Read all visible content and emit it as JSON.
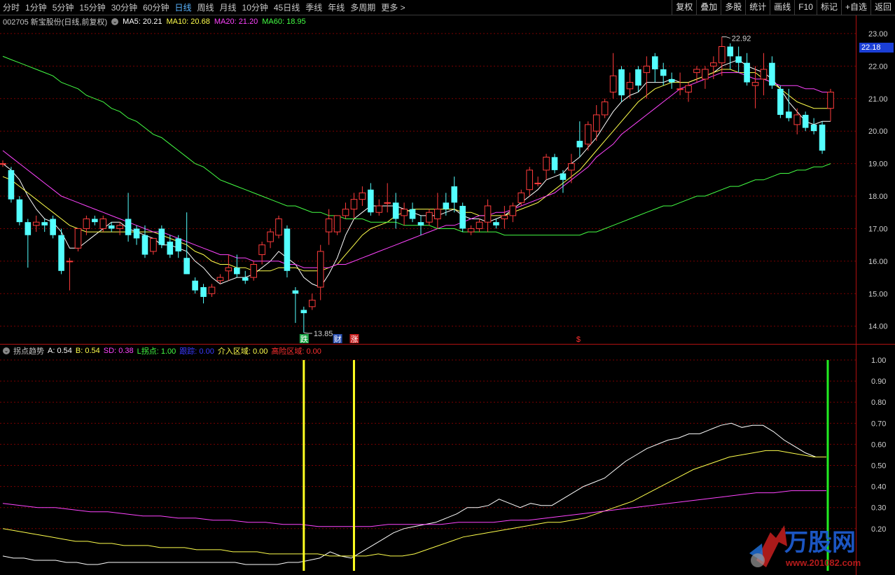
{
  "toolbar": {
    "periods": [
      "分时",
      "1分钟",
      "5分钟",
      "15分钟",
      "30分钟",
      "60分钟",
      "日线",
      "周线",
      "月线",
      "10分钟",
      "45日线",
      "季线",
      "年线",
      "多周期",
      "更多 >"
    ],
    "active_period": "日线",
    "buttons": [
      "复权",
      "叠加",
      "多股",
      "统计",
      "画线",
      "F10",
      "标记",
      "+自选",
      "返回"
    ]
  },
  "stock": {
    "header": "002705 新宝股份(日线,前复权)",
    "ma5_label": "MA5:",
    "ma5": "20.21",
    "ma10_label": "MA10:",
    "ma10": "20.68",
    "ma20_label": "MA20:",
    "ma20": "21.20",
    "ma60_label": "MA60:",
    "ma60": "18.95",
    "current_price": "22.18",
    "high_marker": "22.92",
    "low_marker": "13.85",
    "axis_labels": [
      "23.00",
      "22.00",
      "21.00",
      "20.00",
      "19.00",
      "18.00",
      "17.00",
      "16.00",
      "15.00",
      "14.00"
    ],
    "event_tags": [
      {
        "label": "跌",
        "color": "#1fa84a"
      },
      {
        "label": "财",
        "color": "#2a4fb0"
      },
      {
        "label": "涨",
        "color": "#c81e1e"
      },
      {
        "label": "$",
        "color": "#ff3030"
      }
    ]
  },
  "indicator": {
    "name": "拐点趋势",
    "a_label": "A:",
    "a": "0.54",
    "b_label": "B:",
    "b": "0.54",
    "sd_label": "SD:",
    "sd": "0.38",
    "l_label": "L拐点:",
    "l": "1.00",
    "track_label": "跟踪:",
    "track": "0.00",
    "entry_label": "介入区域:",
    "entry": "0.00",
    "risk_label": "高险区域:",
    "risk": "0.00",
    "axis_labels": [
      "1.00",
      "0.90",
      "0.80",
      "0.70",
      "0.60",
      "0.50",
      "0.40",
      "0.30",
      "0.20"
    ]
  },
  "watermark": {
    "brand": "万股网",
    "url": "www.201082.com"
  },
  "colors": {
    "up": "#ff3c3c",
    "down": "#54ffff",
    "ma5": "#ffffff",
    "ma10": "#ffff4c",
    "ma20": "#ff44ff",
    "ma60": "#44ff44",
    "grid": "#7a0000"
  },
  "chart_data": {
    "type": "candlestick",
    "ylim": [
      13.8,
      23.3
    ],
    "candles": [
      [
        19.0,
        19.1,
        18.9,
        19.0
      ],
      [
        18.8,
        18.9,
        17.8,
        17.9
      ],
      [
        17.9,
        18.0,
        17.1,
        17.2
      ],
      [
        17.2,
        17.3,
        15.8,
        16.8
      ],
      [
        17.1,
        17.4,
        16.9,
        17.2
      ],
      [
        17.2,
        17.3,
        16.9,
        17.1
      ],
      [
        17.3,
        17.4,
        16.7,
        16.8
      ],
      [
        16.8,
        17.0,
        15.6,
        15.7
      ],
      [
        16.0,
        16.1,
        15.1,
        16.0
      ],
      [
        16.4,
        17.0,
        16.3,
        17.0
      ],
      [
        17.0,
        17.4,
        16.8,
        17.3
      ],
      [
        17.3,
        17.4,
        17.1,
        17.2
      ],
      [
        17.0,
        17.4,
        16.9,
        17.3
      ],
      [
        17.1,
        17.2,
        16.9,
        17.0
      ],
      [
        17.0,
        17.2,
        16.8,
        17.1
      ],
      [
        17.3,
        18.1,
        16.6,
        16.8
      ],
      [
        17.0,
        17.1,
        16.5,
        16.7
      ],
      [
        16.8,
        17.1,
        16.1,
        16.2
      ],
      [
        16.3,
        16.7,
        16.2,
        16.7
      ],
      [
        17.0,
        17.1,
        16.4,
        16.5
      ],
      [
        16.6,
        16.8,
        16.1,
        16.2
      ],
      [
        16.7,
        16.8,
        16.1,
        16.3
      ],
      [
        16.1,
        17.5,
        15.6,
        15.6
      ],
      [
        15.4,
        15.5,
        15.0,
        15.1
      ],
      [
        15.2,
        15.3,
        14.7,
        14.9
      ],
      [
        15.0,
        15.3,
        14.9,
        15.2
      ],
      [
        15.4,
        15.6,
        15.3,
        15.5
      ],
      [
        15.7,
        16.2,
        15.4,
        15.8
      ],
      [
        15.8,
        16.2,
        15.5,
        15.6
      ],
      [
        15.5,
        15.7,
        15.3,
        15.4
      ],
      [
        15.5,
        16.0,
        15.4,
        15.9
      ],
      [
        16.2,
        16.6,
        15.9,
        16.5
      ],
      [
        16.6,
        17.0,
        16.4,
        16.9
      ],
      [
        16.8,
        17.4,
        16.7,
        17.3
      ],
      [
        17.0,
        17.1,
        15.5,
        15.7
      ],
      [
        15.1,
        15.2,
        14.1,
        15.0
      ],
      [
        14.5,
        14.6,
        13.8,
        14.4
      ],
      [
        14.6,
        15.0,
        14.5,
        14.8
      ],
      [
        15.2,
        16.5,
        14.8,
        16.3
      ],
      [
        16.9,
        17.6,
        16.5,
        17.3
      ],
      [
        16.9,
        17.4,
        16.8,
        17.4
      ],
      [
        17.4,
        17.8,
        17.3,
        17.6
      ],
      [
        17.6,
        18.1,
        17.3,
        17.9
      ],
      [
        17.9,
        18.3,
        17.7,
        18.1
      ],
      [
        18.2,
        18.4,
        17.4,
        17.5
      ],
      [
        17.5,
        17.9,
        17.4,
        17.7
      ],
      [
        17.8,
        18.4,
        17.5,
        17.8
      ],
      [
        17.8,
        18.1,
        17.0,
        17.3
      ],
      [
        17.4,
        17.8,
        17.1,
        17.6
      ],
      [
        17.6,
        17.8,
        17.2,
        17.3
      ],
      [
        17.2,
        17.4,
        16.8,
        17.1
      ],
      [
        17.2,
        17.6,
        17.1,
        17.5
      ],
      [
        17.3,
        18.1,
        17.0,
        17.6
      ],
      [
        17.8,
        18.1,
        17.4,
        17.6
      ],
      [
        18.3,
        18.6,
        17.5,
        17.8
      ],
      [
        17.7,
        17.8,
        16.9,
        17.0
      ],
      [
        16.9,
        17.1,
        16.8,
        17.0
      ],
      [
        17.0,
        17.3,
        16.9,
        17.2
      ],
      [
        17.2,
        17.9,
        16.9,
        17.7
      ],
      [
        17.2,
        17.3,
        17.0,
        17.1
      ],
      [
        17.3,
        17.7,
        17.0,
        17.4
      ],
      [
        17.4,
        17.8,
        17.2,
        17.7
      ],
      [
        17.8,
        18.2,
        17.7,
        18.1
      ],
      [
        18.2,
        18.9,
        18.0,
        18.8
      ],
      [
        18.4,
        18.6,
        18.3,
        18.4
      ],
      [
        18.8,
        19.3,
        18.5,
        19.2
      ],
      [
        19.2,
        19.3,
        18.7,
        18.8
      ],
      [
        18.7,
        18.8,
        18.1,
        18.5
      ],
      [
        18.8,
        19.3,
        18.4,
        19.0
      ],
      [
        19.7,
        20.3,
        19.2,
        19.5
      ],
      [
        19.6,
        20.3,
        19.4,
        20.2
      ],
      [
        20.0,
        20.8,
        19.7,
        20.5
      ],
      [
        20.5,
        21.0,
        20.4,
        20.9
      ],
      [
        21.2,
        22.4,
        21.0,
        21.7
      ],
      [
        21.9,
        22.0,
        20.9,
        21.1
      ],
      [
        21.3,
        21.8,
        21.0,
        21.5
      ],
      [
        21.9,
        22.0,
        21.2,
        21.4
      ],
      [
        21.8,
        22.3,
        21.0,
        22.0
      ],
      [
        22.3,
        22.4,
        21.5,
        21.9
      ],
      [
        21.9,
        22.1,
        21.4,
        21.7
      ],
      [
        21.6,
        21.8,
        21.3,
        21.5
      ],
      [
        21.3,
        21.8,
        21.1,
        21.3
      ],
      [
        21.2,
        21.5,
        20.9,
        21.4
      ],
      [
        21.8,
        22.0,
        21.5,
        21.9
      ],
      [
        21.6,
        22.0,
        21.3,
        21.9
      ],
      [
        22.0,
        22.3,
        21.6,
        22.1
      ],
      [
        22.1,
        22.9,
        21.7,
        22.6
      ],
      [
        22.6,
        22.7,
        21.9,
        22.3
      ],
      [
        22.3,
        22.6,
        21.8,
        22.1
      ],
      [
        22.1,
        22.4,
        21.4,
        21.5
      ],
      [
        21.4,
        22.0,
        20.7,
        21.5
      ],
      [
        21.6,
        22.4,
        21.1,
        21.9
      ],
      [
        22.1,
        22.3,
        21.3,
        21.4
      ],
      [
        21.3,
        21.4,
        20.4,
        20.5
      ],
      [
        20.6,
        21.3,
        20.3,
        20.4
      ],
      [
        20.2,
        20.7,
        19.9,
        20.5
      ],
      [
        20.5,
        20.6,
        20.0,
        20.1
      ],
      [
        20.2,
        20.4,
        19.9,
        20.0
      ],
      [
        20.2,
        20.3,
        19.3,
        19.4
      ],
      [
        20.7,
        21.3,
        20.3,
        21.2
      ]
    ],
    "series": [
      {
        "name": "MA5",
        "values": [
          19.0,
          18.8,
          18.5,
          18.0,
          17.6,
          17.3,
          17.2,
          16.9,
          16.4,
          16.4,
          16.6,
          16.8,
          17.0,
          17.2,
          17.2,
          17.0,
          16.9,
          16.8,
          16.7,
          16.5,
          16.5,
          16.4,
          16.3,
          16.0,
          15.8,
          15.5,
          15.3,
          15.4,
          15.5,
          15.5,
          15.6,
          15.8,
          16.0,
          16.3,
          16.1,
          15.9,
          15.5,
          15.3,
          15.2,
          15.6,
          16.1,
          16.8,
          17.3,
          17.5,
          17.7,
          17.7,
          17.7,
          17.7,
          17.6,
          17.5,
          17.4,
          17.4,
          17.4,
          17.5,
          17.6,
          17.4,
          17.3,
          17.3,
          17.2,
          17.3,
          17.4,
          17.6,
          17.8,
          18.0,
          18.2,
          18.5,
          18.6,
          18.7,
          19.0,
          19.2,
          19.5,
          19.8,
          20.2,
          20.6,
          20.9,
          21.1,
          21.2,
          21.5,
          21.5,
          21.5,
          21.6,
          21.5,
          21.5,
          21.6,
          21.7,
          21.8,
          22.0,
          22.1,
          22.2,
          22.0,
          21.9,
          21.8,
          21.6,
          21.3,
          20.9,
          20.6,
          20.3,
          20.2,
          20.3,
          20.3
        ]
      },
      {
        "name": "MA10",
        "values": [
          18.6,
          18.5,
          18.3,
          18.1,
          17.9,
          17.7,
          17.5,
          17.3,
          17.1,
          17.0,
          16.9,
          16.9,
          16.9,
          16.9,
          16.9,
          16.9,
          16.9,
          16.9,
          16.9,
          16.8,
          16.7,
          16.6,
          16.5,
          16.3,
          16.2,
          16.0,
          15.9,
          15.9,
          15.8,
          15.8,
          15.7,
          15.7,
          15.7,
          15.8,
          15.8,
          15.8,
          15.7,
          15.7,
          15.7,
          15.8,
          15.9,
          16.2,
          16.5,
          16.8,
          17.0,
          17.1,
          17.2,
          17.4,
          17.5,
          17.6,
          17.6,
          17.6,
          17.6,
          17.6,
          17.6,
          17.5,
          17.5,
          17.4,
          17.4,
          17.4,
          17.4,
          17.5,
          17.6,
          17.7,
          17.8,
          18.0,
          18.2,
          18.4,
          18.6,
          18.8,
          19.1,
          19.4,
          19.7,
          20.0,
          20.3,
          20.6,
          20.9,
          21.1,
          21.3,
          21.4,
          21.5,
          21.5,
          21.5,
          21.6,
          21.7,
          21.8,
          21.9,
          21.9,
          21.8,
          21.8,
          21.8,
          21.6,
          21.5,
          21.3,
          21.1,
          20.9,
          20.8,
          20.7,
          20.7,
          20.7
        ]
      },
      {
        "name": "MA20",
        "values": [
          19.4,
          19.2,
          19.0,
          18.8,
          18.6,
          18.4,
          18.2,
          18.0,
          17.9,
          17.8,
          17.7,
          17.6,
          17.5,
          17.4,
          17.3,
          17.2,
          17.1,
          17.0,
          16.9,
          16.9,
          16.8,
          16.7,
          16.6,
          16.5,
          16.4,
          16.3,
          16.2,
          16.2,
          16.1,
          16.1,
          16.0,
          16.0,
          16.0,
          16.0,
          15.9,
          15.9,
          15.8,
          15.8,
          15.8,
          15.8,
          15.9,
          15.9,
          16.0,
          16.1,
          16.2,
          16.3,
          16.4,
          16.5,
          16.6,
          16.7,
          16.8,
          16.9,
          17.0,
          17.1,
          17.1,
          17.2,
          17.3,
          17.4,
          17.4,
          17.5,
          17.5,
          17.6,
          17.7,
          17.8,
          17.9,
          18.0,
          18.1,
          18.3,
          18.5,
          18.7,
          18.9,
          19.2,
          19.4,
          19.6,
          19.9,
          20.1,
          20.3,
          20.5,
          20.7,
          20.9,
          21.1,
          21.3,
          21.4,
          21.5,
          21.6,
          21.7,
          21.8,
          21.8,
          21.8,
          21.7,
          21.6,
          21.6,
          21.5,
          21.4,
          21.4,
          21.4,
          21.3,
          21.3,
          21.2,
          21.2
        ]
      },
      {
        "name": "MA60",
        "values": [
          22.3,
          22.2,
          22.1,
          22.0,
          21.9,
          21.8,
          21.7,
          21.5,
          21.4,
          21.3,
          21.1,
          21.0,
          20.9,
          20.7,
          20.6,
          20.4,
          20.3,
          20.1,
          19.9,
          19.8,
          19.6,
          19.4,
          19.2,
          19.0,
          18.9,
          18.7,
          18.5,
          18.4,
          18.3,
          18.2,
          18.1,
          18.0,
          17.9,
          17.8,
          17.7,
          17.7,
          17.6,
          17.5,
          17.5,
          17.4,
          17.4,
          17.3,
          17.3,
          17.3,
          17.2,
          17.2,
          17.2,
          17.2,
          17.1,
          17.1,
          17.1,
          17.1,
          17.0,
          17.0,
          17.0,
          16.9,
          16.9,
          16.9,
          16.9,
          16.9,
          16.8,
          16.8,
          16.8,
          16.8,
          16.8,
          16.8,
          16.8,
          16.8,
          16.8,
          16.8,
          16.9,
          16.9,
          17.0,
          17.1,
          17.2,
          17.3,
          17.4,
          17.5,
          17.6,
          17.7,
          17.7,
          17.8,
          17.9,
          18.0,
          18.0,
          18.1,
          18.2,
          18.3,
          18.3,
          18.4,
          18.5,
          18.5,
          18.6,
          18.7,
          18.7,
          18.8,
          18.8,
          18.9,
          18.9,
          19.0
        ]
      },
      {
        "name": "A",
        "values": [
          0.07,
          0.06,
          0.06,
          0.05,
          0.05,
          0.05,
          0.04,
          0.04,
          0.03,
          0.03,
          0.04,
          0.04,
          0.04,
          0.04,
          0.04,
          0.04,
          0.04,
          0.04,
          0.04,
          0.04,
          0.04,
          0.04,
          0.04,
          0.03,
          0.03,
          0.03,
          0.03,
          0.04,
          0.04,
          0.05,
          0.06,
          0.09,
          0.07,
          0.06,
          0.09,
          0.12,
          0.15,
          0.18,
          0.2,
          0.21,
          0.22,
          0.23,
          0.25,
          0.27,
          0.3,
          0.3,
          0.31,
          0.34,
          0.32,
          0.3,
          0.32,
          0.31,
          0.31,
          0.34,
          0.37,
          0.4,
          0.42,
          0.44,
          0.48,
          0.52,
          0.55,
          0.58,
          0.6,
          0.62,
          0.63,
          0.65,
          0.65,
          0.67,
          0.69,
          0.7,
          0.68,
          0.69,
          0.69,
          0.66,
          0.62,
          0.59,
          0.56,
          0.54,
          0.54
        ]
      },
      {
        "name": "B",
        "values": [
          0.2,
          0.19,
          0.18,
          0.17,
          0.16,
          0.15,
          0.14,
          0.14,
          0.13,
          0.13,
          0.12,
          0.12,
          0.12,
          0.11,
          0.11,
          0.11,
          0.1,
          0.1,
          0.1,
          0.09,
          0.09,
          0.09,
          0.08,
          0.08,
          0.08,
          0.08,
          0.08,
          0.07,
          0.07,
          0.07,
          0.07,
          0.08,
          0.07,
          0.07,
          0.08,
          0.1,
          0.12,
          0.14,
          0.16,
          0.17,
          0.18,
          0.19,
          0.2,
          0.21,
          0.22,
          0.23,
          0.23,
          0.24,
          0.25,
          0.27,
          0.29,
          0.31,
          0.33,
          0.36,
          0.39,
          0.42,
          0.45,
          0.48,
          0.5,
          0.52,
          0.54,
          0.55,
          0.56,
          0.57,
          0.57,
          0.56,
          0.55,
          0.54,
          0.54
        ]
      },
      {
        "name": "SD",
        "values": [
          0.32,
          0.31,
          0.3,
          0.3,
          0.29,
          0.28,
          0.28,
          0.27,
          0.26,
          0.26,
          0.25,
          0.25,
          0.24,
          0.24,
          0.23,
          0.23,
          0.22,
          0.22,
          0.21,
          0.21,
          0.21,
          0.21,
          0.22,
          0.22,
          0.22,
          0.22,
          0.23,
          0.23,
          0.23,
          0.24,
          0.24,
          0.25,
          0.26,
          0.27,
          0.28,
          0.29,
          0.3,
          0.31,
          0.32,
          0.33,
          0.34,
          0.35,
          0.36,
          0.37,
          0.37,
          0.38,
          0.38,
          0.38
        ]
      }
    ],
    "signals": [
      {
        "bar": 36,
        "color": "yellow",
        "value": 1.0
      },
      {
        "bar": 42,
        "color": "yellow",
        "value": 1.0
      },
      {
        "bar": 99,
        "color": "green",
        "value": 1.0
      }
    ],
    "indicator_ylim": [
      0.0,
      1.02
    ]
  }
}
